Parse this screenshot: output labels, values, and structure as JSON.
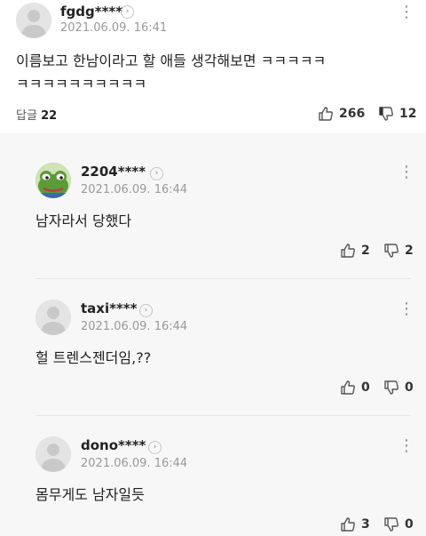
{
  "main_comment": {
    "nickname": "fgdg****",
    "date": "2021.06.09. 16:41",
    "text_line1": "이름보고 한남이라고 할 애들 생각해보면 ㅋㅋㅋㅋㅋ",
    "text_line2": "ㅋㅋㅋㅋㅋㅋㅋㅋㅋㅋ",
    "reply_label": "답글",
    "reply_count": "22",
    "likes": "266",
    "dislikes": "12"
  },
  "replies": [
    {
      "nickname": "2204****",
      "date": "2021.06.09. 16:44",
      "text": "남자라서 당했다",
      "likes": "2",
      "dislikes": "2",
      "avatar": "frog"
    },
    {
      "nickname": "taxi****",
      "date": "2021.06.09. 16:44",
      "text": "헐 트렌스젠더임,??",
      "likes": "0",
      "dislikes": "0",
      "avatar": "default"
    },
    {
      "nickname": "dono****",
      "date": "2021.06.09. 16:44",
      "text": "몸무게도 남자일듯",
      "likes": "3",
      "dislikes": "0",
      "avatar": "default"
    }
  ],
  "icons": {
    "chevron": "›",
    "more": "⋮"
  }
}
